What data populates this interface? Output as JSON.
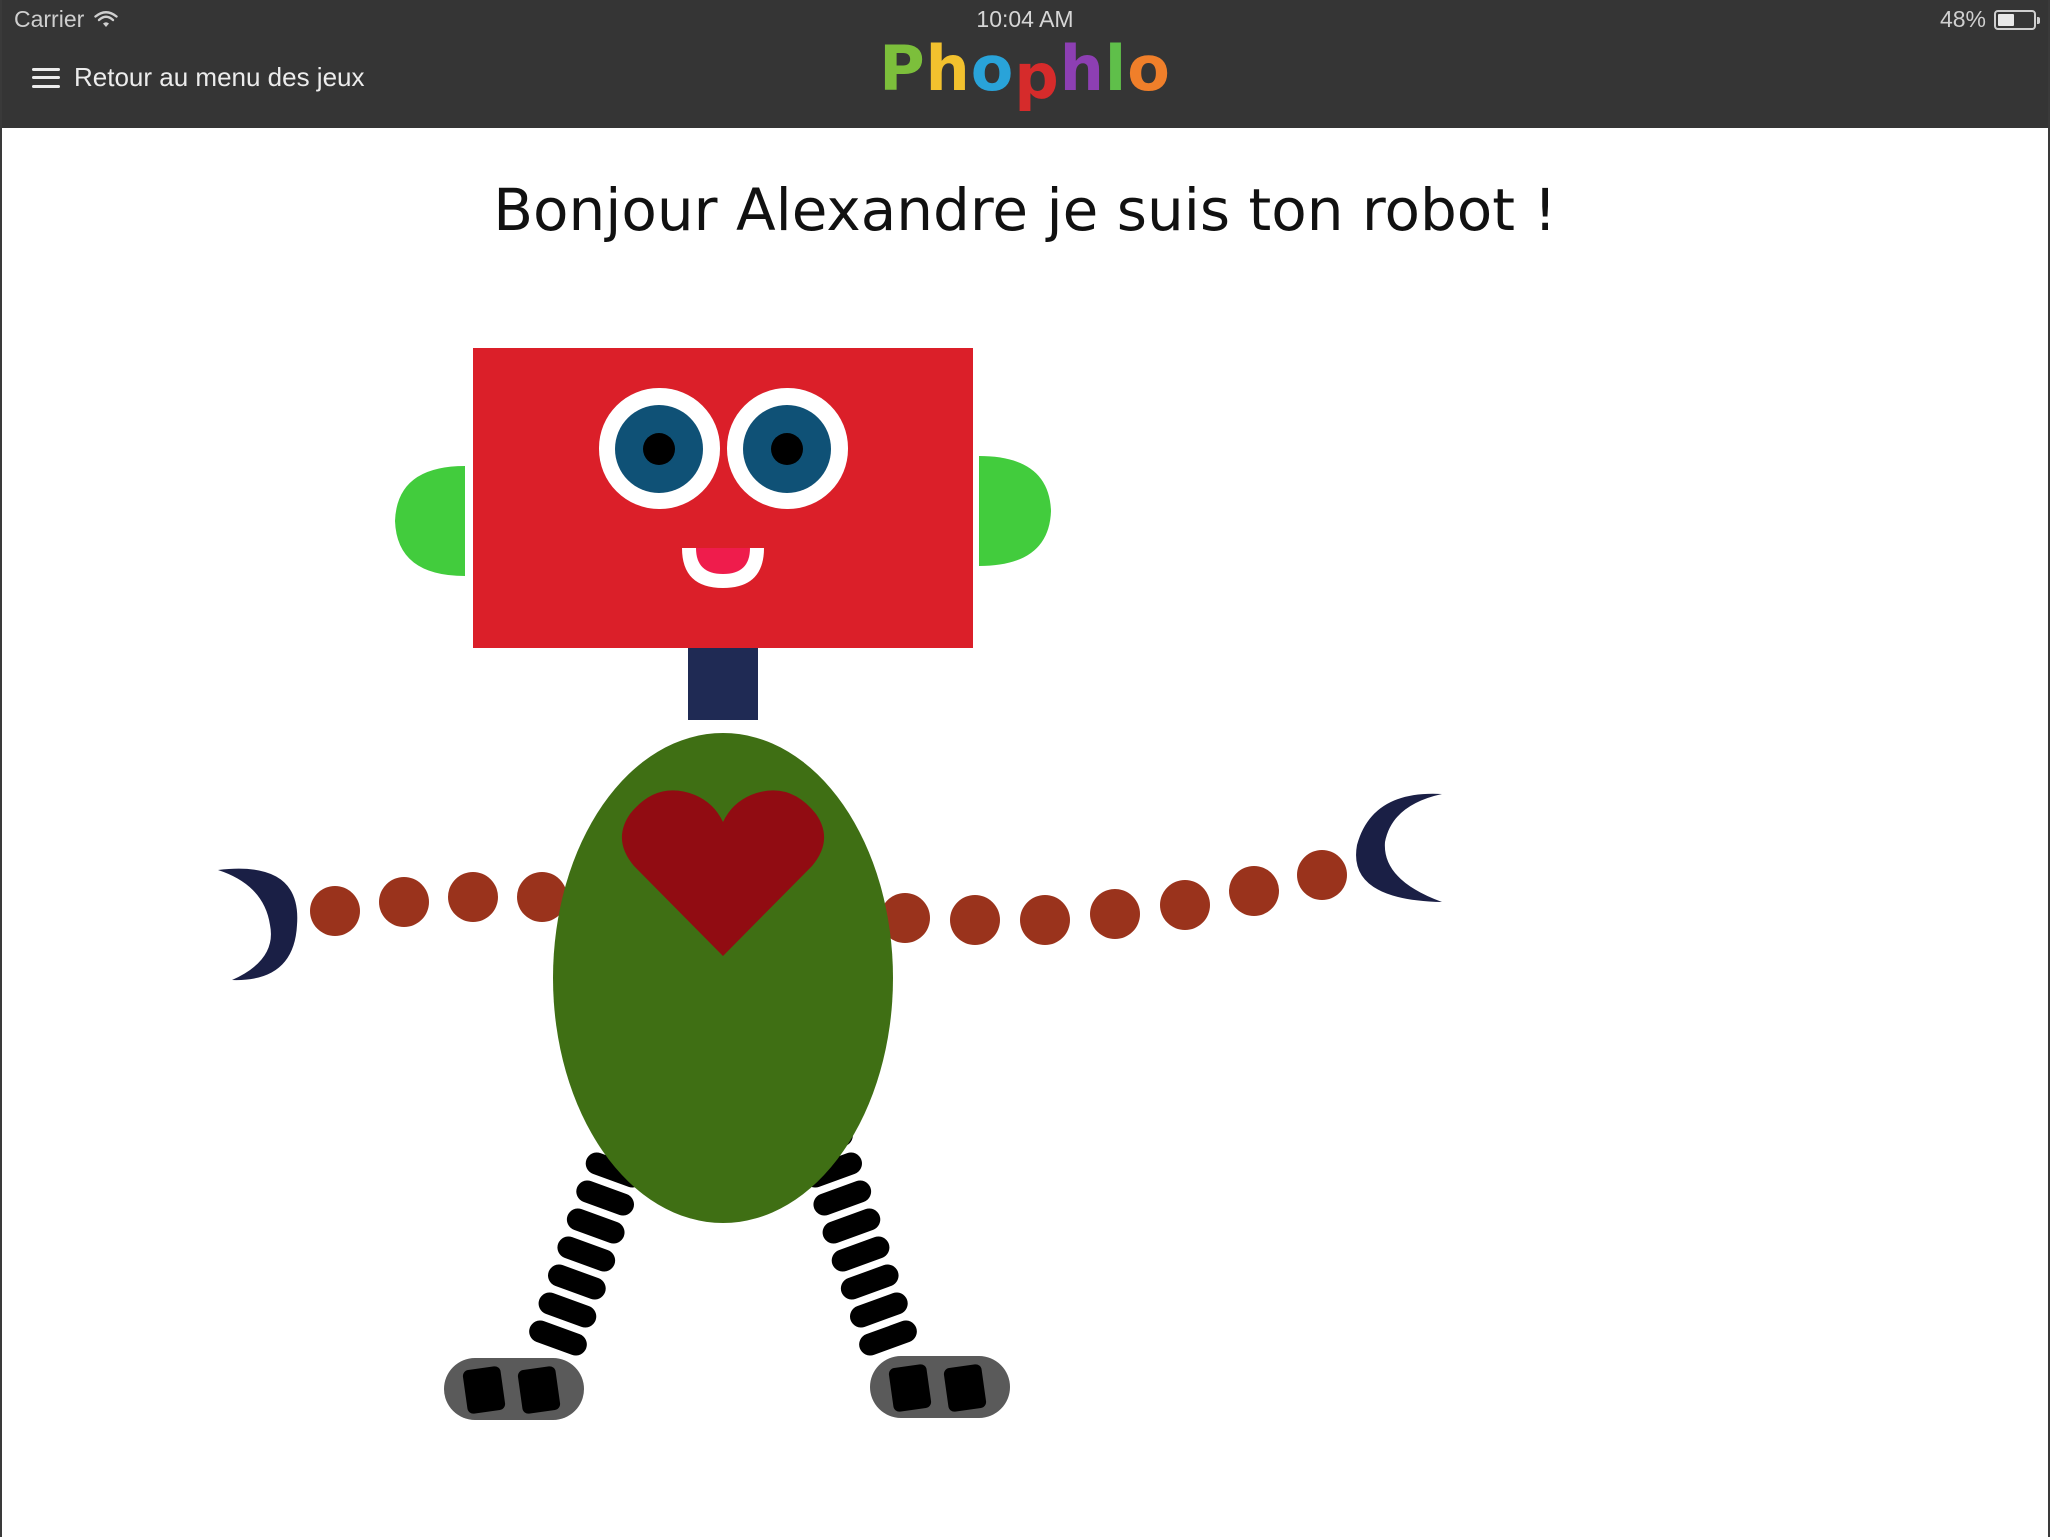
{
  "status_bar": {
    "carrier": "Carrier",
    "time": "10:04 AM",
    "battery_percent": "48%",
    "battery_level": 0.48
  },
  "nav": {
    "back_label": "Retour au menu des jeux",
    "logo_letters": [
      {
        "char": "P",
        "color": "#7cbf3b"
      },
      {
        "char": "h",
        "color": "#f2c12e"
      },
      {
        "char": "o",
        "color": "#29a3d9"
      },
      {
        "char": "p",
        "color": "#d62b2b"
      },
      {
        "char": "h",
        "color": "#8d3fb3"
      },
      {
        "char": "l",
        "color": "#5fbf4a"
      },
      {
        "char": "o",
        "color": "#f07f2a"
      }
    ]
  },
  "main": {
    "greeting": "Bonjour Alexandre je suis ton robot !"
  },
  "robot": {
    "colors": {
      "head": "#db1f29",
      "ears": "#42cc3d",
      "eye_white": "#ffffff",
      "iris": "#0f5176",
      "pupil": "#000000",
      "mouth": "#ef1c4c",
      "neck": "#1f2a54",
      "body": "#3f6f14",
      "heart": "#910c12",
      "arm_joints": "#9a331c",
      "hands": "#1a1f45",
      "legs": "#000000",
      "feet": "#5a5a5a"
    }
  }
}
